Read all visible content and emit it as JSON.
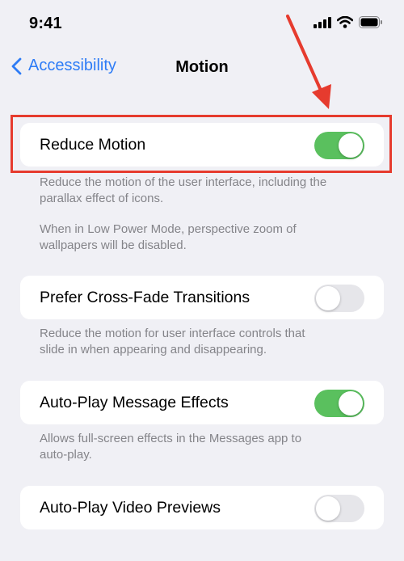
{
  "status_bar": {
    "time": "9:41"
  },
  "nav": {
    "back_label": "Accessibility",
    "title": "Motion"
  },
  "settings": [
    {
      "label": "Reduce Motion",
      "enabled": true,
      "footnote_lines": [
        "Reduce the motion of the user interface, including the",
        "parallax effect of icons.",
        "",
        "When in Low Power Mode, perspective zoom of",
        "wallpapers will be disabled."
      ]
    },
    {
      "label": "Prefer Cross-Fade Transitions",
      "enabled": false,
      "footnote_lines": [
        "Reduce the motion for user interface controls that",
        "slide in when appearing and disappearing."
      ]
    },
    {
      "label": "Auto-Play Message Effects",
      "enabled": true,
      "footnote_lines": [
        "Allows full-screen effects in the Messages app to",
        "auto-play."
      ]
    },
    {
      "label": "Auto-Play Video Previews",
      "enabled": false
    }
  ],
  "colors": {
    "toggle_on": "#5ac05e",
    "link_blue": "#2e7cf6",
    "annotation_red": "#e63b2e"
  }
}
